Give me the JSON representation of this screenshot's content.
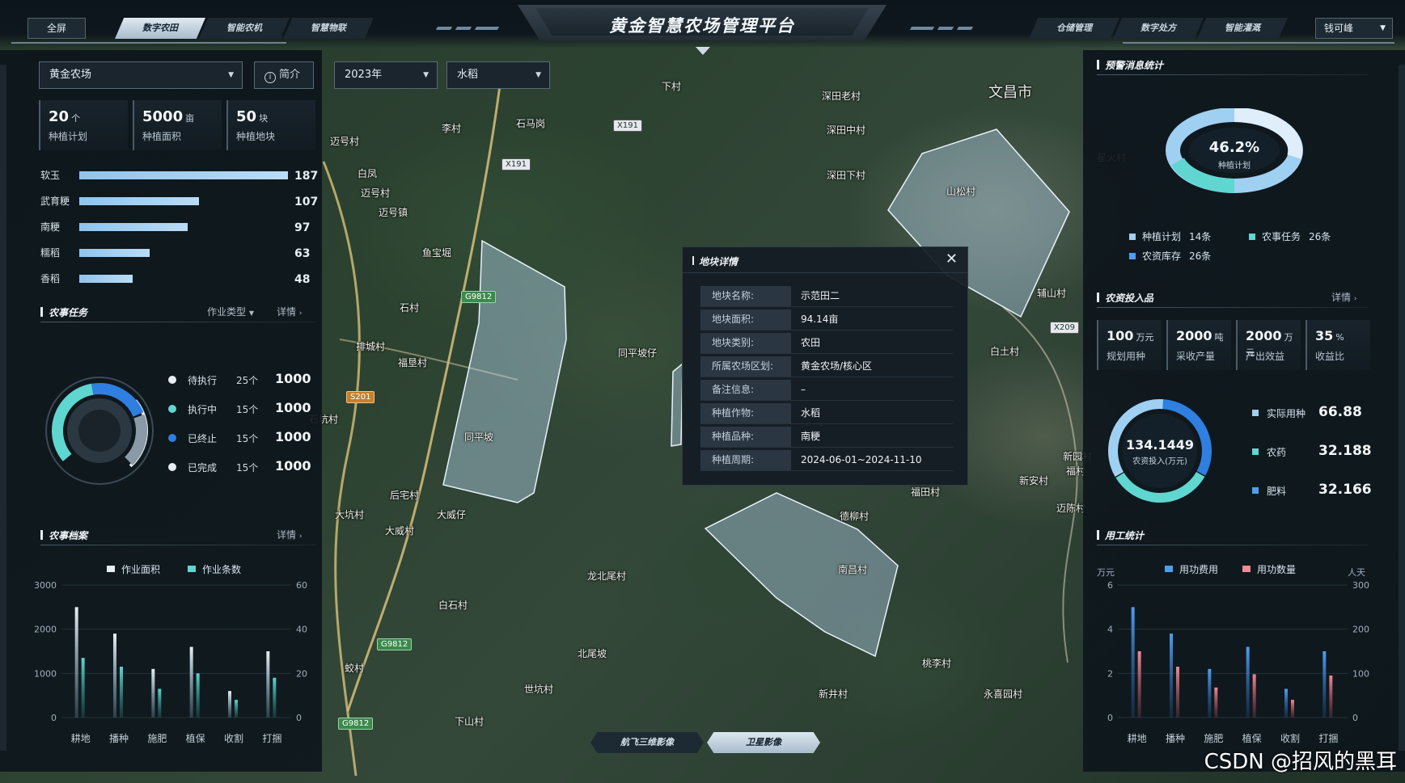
{
  "header": {
    "title": "黄金智慧农场管理平台",
    "fullscreen": "全屏",
    "left_tabs": [
      {
        "label": "数字农田",
        "active": true
      },
      {
        "label": "智能农机",
        "active": false
      },
      {
        "label": "智慧物联",
        "active": false
      }
    ],
    "right_tabs": [
      {
        "label": "仓储管理"
      },
      {
        "label": "数字处方"
      },
      {
        "label": "智能灌溉"
      }
    ],
    "user": "钱可峰"
  },
  "left": {
    "farm_select": "黄金农场",
    "intro_button": "简介",
    "stats": [
      {
        "num": "20",
        "unit": "个",
        "label": "种植计划"
      },
      {
        "num": "5000",
        "unit": "亩",
        "label": "种植面积"
      },
      {
        "num": "50",
        "unit": "块",
        "label": "种植地块"
      }
    ],
    "varieties": [
      {
        "name": "软玉",
        "value": 187
      },
      {
        "name": "武育粳",
        "value": 107
      },
      {
        "name": "南粳",
        "value": 97
      },
      {
        "name": "糯稻",
        "value": 63
      },
      {
        "name": "香稻",
        "value": 48
      }
    ],
    "tasks": {
      "title": "农事任务",
      "filter": "作业类型",
      "detail": "详情",
      "items": [
        {
          "name": "待执行",
          "count": "25个",
          "value": "1000",
          "color": "#e6eef4"
        },
        {
          "name": "执行中",
          "count": "15个",
          "value": "1000",
          "color": "#5fd6d0"
        },
        {
          "name": "已终止",
          "count": "15个",
          "value": "1000",
          "color": "#2f7fe0"
        },
        {
          "name": "已完成",
          "count": "15个",
          "value": "1000",
          "color": "#e6eef4"
        }
      ]
    },
    "archive": {
      "title": "农事档案",
      "detail": "详情",
      "legend": [
        "作业面积",
        "作业条数"
      ]
    }
  },
  "top_filters": {
    "year": "2023年",
    "crop": "水稻"
  },
  "popup": {
    "title": "地块详情",
    "rows": [
      {
        "k": "地块名称:",
        "v": "示范田二"
      },
      {
        "k": "地块面积:",
        "v": "94.14亩"
      },
      {
        "k": "地块类别:",
        "v": "农田"
      },
      {
        "k": "所属农场区划:",
        "v": "黄金农场/核心区"
      },
      {
        "k": "备注信息:",
        "v": "–"
      },
      {
        "k": "种植作物:",
        "v": "水稻"
      },
      {
        "k": "种植品种:",
        "v": "南粳"
      },
      {
        "k": "种植周期:",
        "v": "2024-06-01~2024-11-10"
      }
    ]
  },
  "map": {
    "buttons": [
      {
        "label": "航飞三维影像",
        "active": false
      },
      {
        "label": "卫星影像",
        "active": true
      }
    ],
    "places": [
      {
        "t": "文昌市",
        "big": true
      },
      {
        "t": "深田老村"
      },
      {
        "t": "深田中村"
      },
      {
        "t": "深田下村"
      },
      {
        "t": "山松村"
      },
      {
        "t": "石马岗"
      },
      {
        "t": "李村"
      },
      {
        "t": "迈号村"
      },
      {
        "t": "白凤"
      },
      {
        "t": "迈号村"
      },
      {
        "t": "迈号镇"
      },
      {
        "t": "鱼宝堀"
      },
      {
        "t": "石村"
      },
      {
        "t": "排城村"
      },
      {
        "t": "福垦村"
      },
      {
        "t": "同平坡仔"
      },
      {
        "t": "同平坡"
      },
      {
        "t": "后宅村"
      },
      {
        "t": "大坑村"
      },
      {
        "t": "大威仔"
      },
      {
        "t": "大威村"
      },
      {
        "t": "龙北尾村"
      },
      {
        "t": "白石村"
      },
      {
        "t": "北尾坡"
      },
      {
        "t": "蛟村"
      },
      {
        "t": "世坑村"
      },
      {
        "t": "下山村"
      },
      {
        "t": "新井村"
      },
      {
        "t": "桃李村"
      },
      {
        "t": "永喜园村"
      },
      {
        "t": "南昌村"
      },
      {
        "t": "德柳村"
      },
      {
        "t": "福田村"
      },
      {
        "t": "新安村"
      },
      {
        "t": "白土村"
      },
      {
        "t": "新园村"
      },
      {
        "t": "福村"
      },
      {
        "t": "迈陈村"
      },
      {
        "t": "辅山村"
      },
      {
        "t": "下村"
      },
      {
        "t": "星火村"
      },
      {
        "t": "石坑村"
      }
    ],
    "roads": [
      {
        "t": "X191",
        "c": "white"
      },
      {
        "t": "X191",
        "c": "white"
      },
      {
        "t": "G9812",
        "c": "green"
      },
      {
        "t": "S201",
        "c": "orange"
      },
      {
        "t": "G9812",
        "c": "green"
      },
      {
        "t": "X209",
        "c": "white"
      },
      {
        "t": "G9812",
        "c": "green"
      }
    ]
  },
  "right": {
    "warn": {
      "title": "预警消息统计",
      "percent": "46.2%",
      "percent_label": "种植计划",
      "legend": [
        {
          "name": "种植计划",
          "count": "14条"
        },
        {
          "name": "农事任务",
          "count": "26条"
        },
        {
          "name": "农资库存",
          "count": "26条"
        }
      ]
    },
    "input": {
      "title": "农资投入品",
      "detail": "详情",
      "stats": [
        {
          "num": "100",
          "unit": "万元",
          "label": "规划用种"
        },
        {
          "num": "2000",
          "unit": "吨",
          "label": "采收产量"
        },
        {
          "num": "2000",
          "unit": "万元",
          "label": "产出效益"
        },
        {
          "num": "35",
          "unit": "%",
          "label": "收益比"
        }
      ],
      "total": "134.1449",
      "total_label": "农资投入(万元)",
      "items": [
        {
          "name": "实际用种",
          "value": "66.88"
        },
        {
          "name": "农药",
          "value": "32.188"
        },
        {
          "name": "肥料",
          "value": "32.166"
        }
      ]
    },
    "labor": {
      "title": "用工统计",
      "legend": [
        "用功费用",
        "用功数量"
      ],
      "yleft_unit": "万元",
      "yright_unit": "人天"
    }
  },
  "chart_data": [
    {
      "type": "bar",
      "title": "农事档案",
      "categories": [
        "耕地",
        "播种",
        "施肥",
        "植保",
        "收割",
        "打捆"
      ],
      "series": [
        {
          "name": "作业面积",
          "values": [
            2500,
            1900,
            1100,
            1600,
            600,
            1500
          ]
        },
        {
          "name": "作业条数",
          "values": [
            27,
            23,
            13,
            20,
            8,
            18
          ]
        }
      ],
      "yticks_left": [
        "0",
        "1000",
        "2000",
        "3000"
      ],
      "yticks_right": [
        "0",
        "20",
        "40",
        "60"
      ],
      "ylim": [
        0,
        3000
      ],
      "ylim_right": [
        0,
        60
      ]
    },
    {
      "type": "bar",
      "title": "用工统计",
      "categories": [
        "耕地",
        "播种",
        "施肥",
        "植保",
        "收割",
        "打捆"
      ],
      "series": [
        {
          "name": "用功费用",
          "values": [
            5,
            3.8,
            2.2,
            3.2,
            1.3,
            3.0
          ]
        },
        {
          "name": "用功数量",
          "values": [
            150,
            115,
            68,
            98,
            40,
            95
          ]
        }
      ],
      "yticks_left": [
        "0",
        "2",
        "4",
        "6"
      ],
      "yticks_right": [
        "0",
        "100",
        "200",
        "300"
      ],
      "ylim": [
        0,
        6
      ],
      "ylim_right": [
        0,
        300
      ]
    }
  ],
  "watermark": "CSDN @招风的黑耳"
}
